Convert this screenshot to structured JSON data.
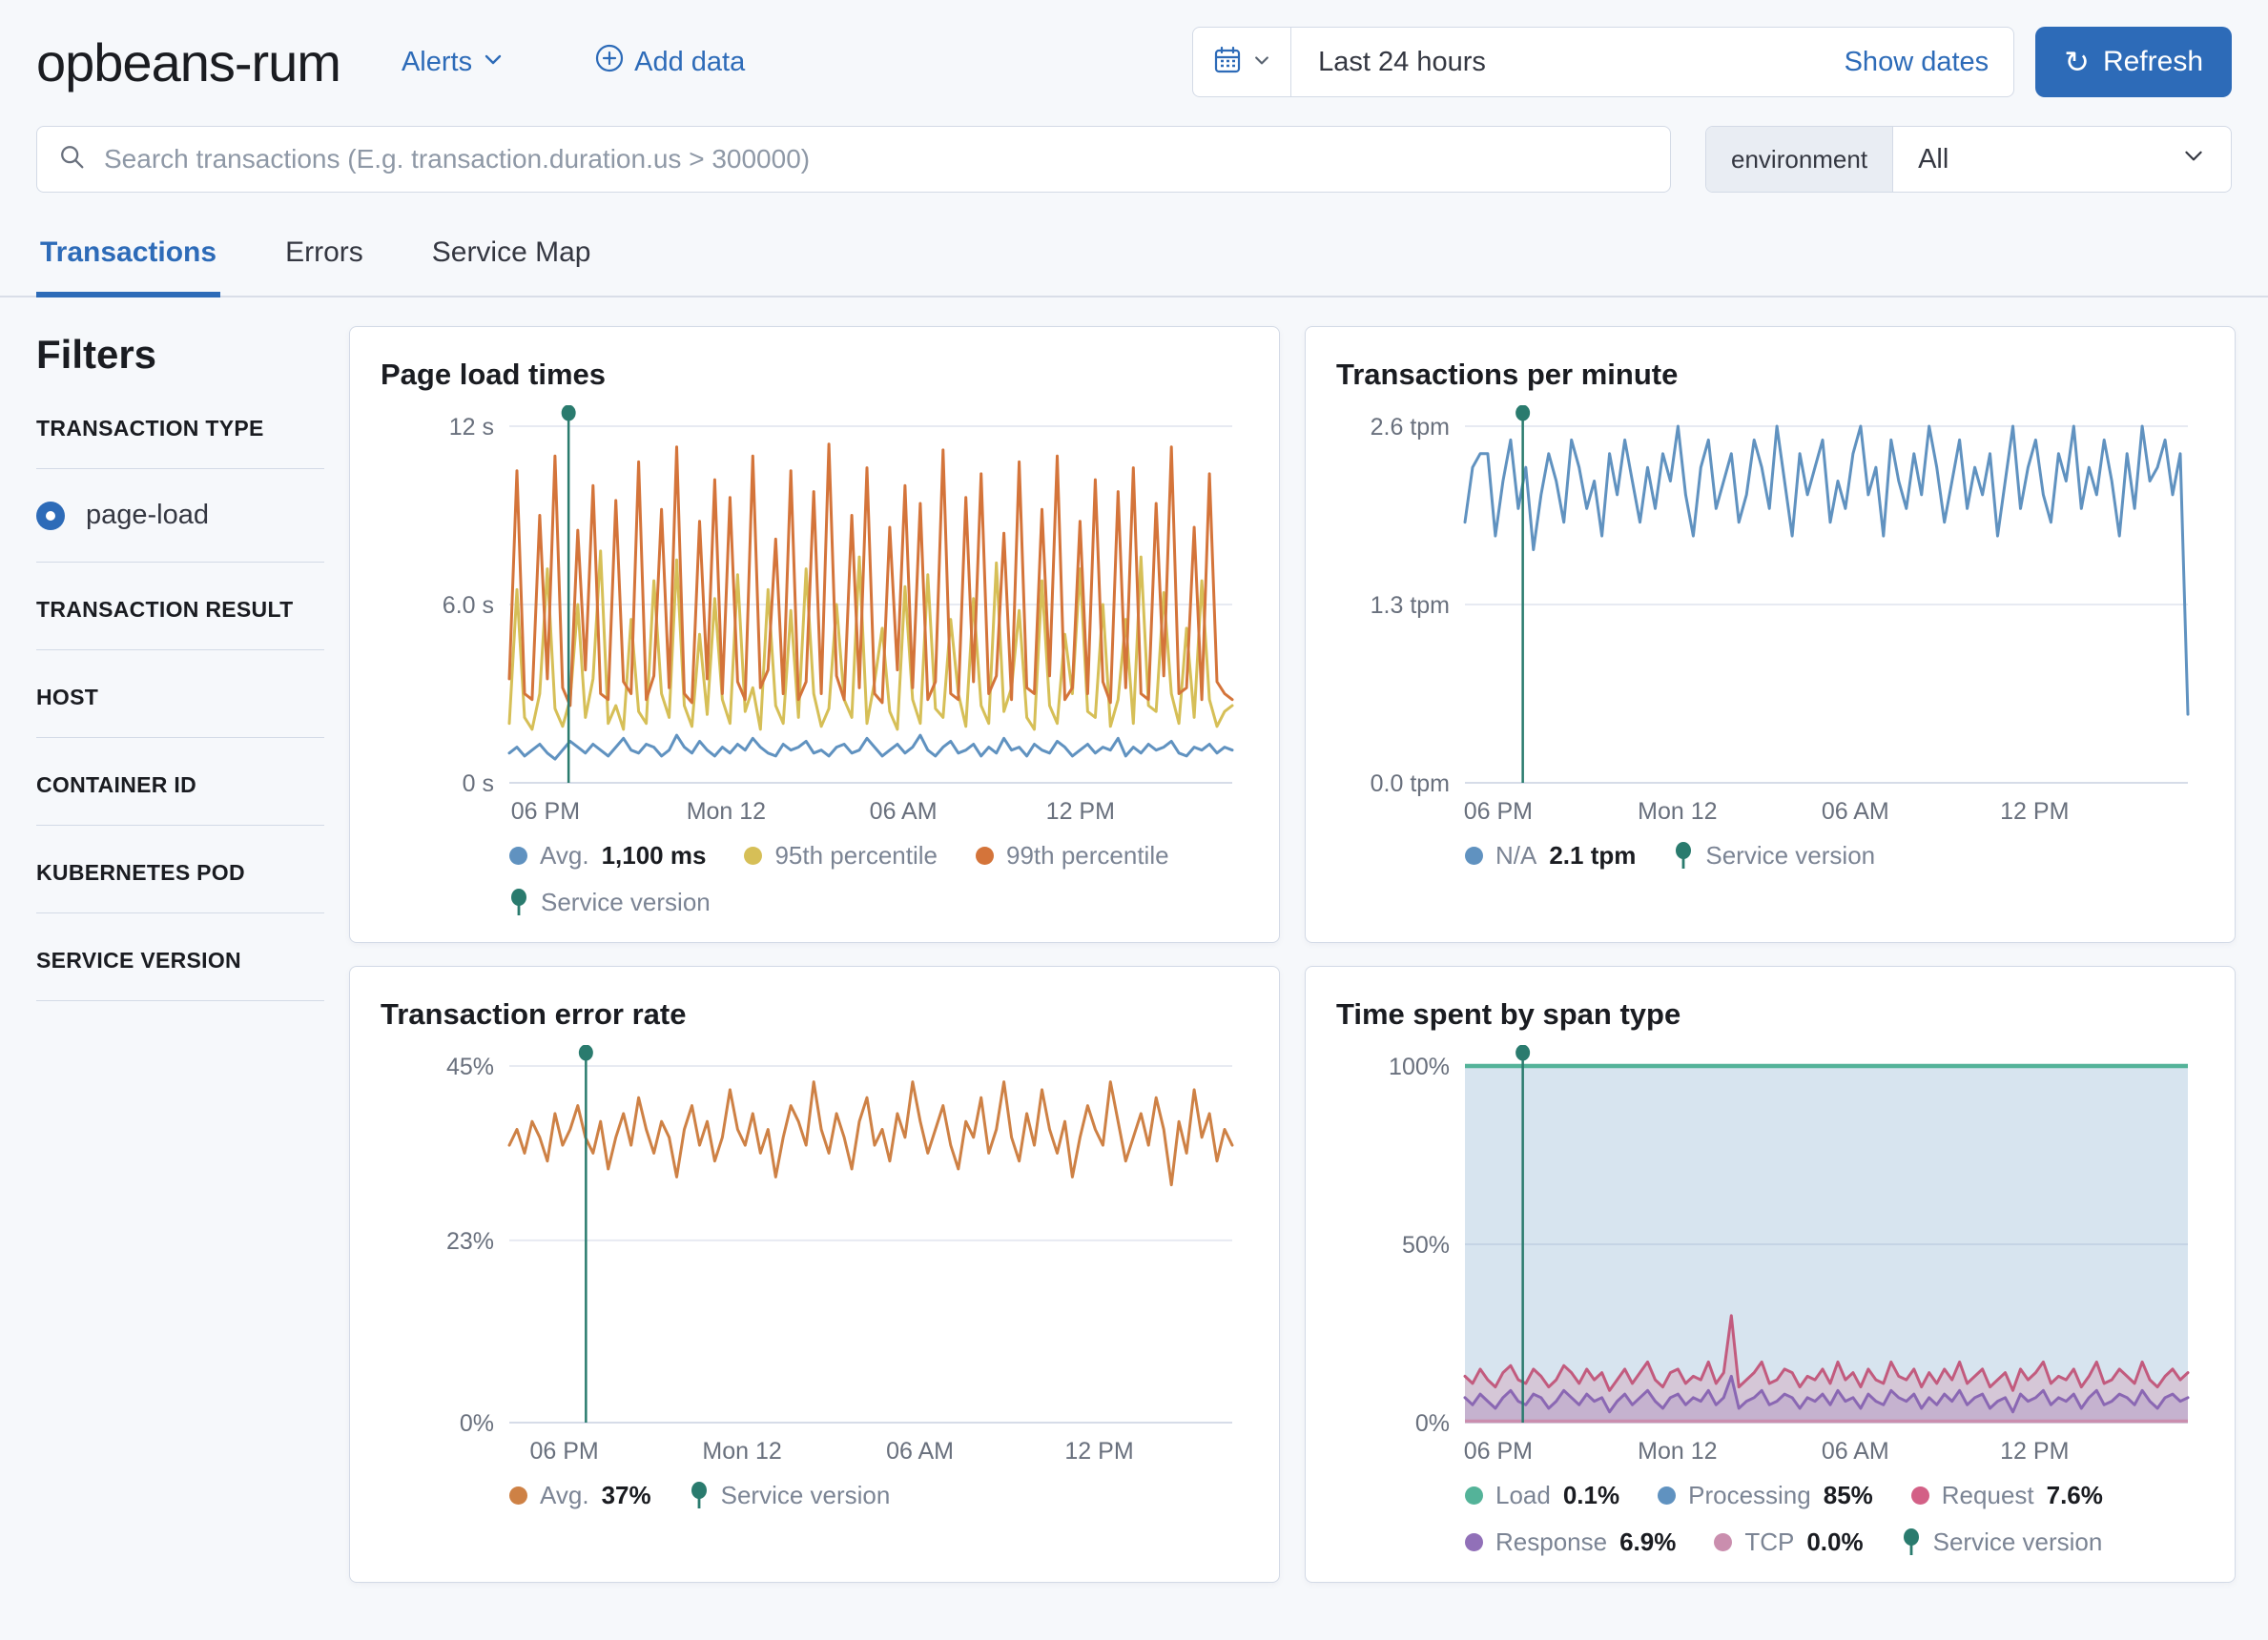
{
  "header": {
    "title": "opbeans-rum",
    "alerts_label": "Alerts",
    "add_data_label": "Add data",
    "time_range": "Last 24 hours",
    "show_dates_label": "Show dates",
    "refresh_label": "Refresh"
  },
  "search": {
    "placeholder": "Search transactions (E.g. transaction.duration.us > 300000)",
    "environment_label": "environment",
    "environment_value": "All"
  },
  "tabs": [
    {
      "label": "Transactions",
      "active": true
    },
    {
      "label": "Errors",
      "active": false
    },
    {
      "label": "Service Map",
      "active": false
    }
  ],
  "filters": {
    "title": "Filters",
    "groups": [
      {
        "label": "TRANSACTION TYPE",
        "options": [
          {
            "label": "page-load",
            "selected": true
          }
        ]
      },
      {
        "label": "TRANSACTION RESULT",
        "options": []
      },
      {
        "label": "HOST",
        "options": []
      },
      {
        "label": "CONTAINER ID",
        "options": []
      },
      {
        "label": "KUBERNETES POD",
        "options": []
      },
      {
        "label": "SERVICE VERSION",
        "options": []
      }
    ]
  },
  "colors": {
    "primary_blue": "#2d6bb8",
    "series_blue": "#6092C0",
    "series_yellow": "#D6BF57",
    "series_orange_99th": "#D4743A",
    "series_orange_avg": "#CE8145",
    "series_green": "#54B399",
    "series_pink": "#D36086",
    "series_purple": "#9170B8",
    "series_light_pink": "#CA8EAE",
    "annotation_teal": "#2a7b6e",
    "border": "#d3dae6",
    "page_bg": "#f6f8fb"
  },
  "chart_data": [
    {
      "type": "line",
      "title": "Page load times",
      "ylim": [
        0,
        12
      ],
      "y_ticks": [
        {
          "label": "12 s",
          "value": 12
        },
        {
          "label": "6.0 s",
          "value": 6
        },
        {
          "label": "0 s",
          "value": 0
        }
      ],
      "x_ticks": [
        "06 PM",
        "Mon 12",
        "06 AM",
        "12 PM"
      ],
      "x_tick_fracs": [
        0.05,
        0.3,
        0.545,
        0.79
      ],
      "annotation": {
        "label": "Service version",
        "x_frac": 0.082,
        "color": "#2a7b6e"
      },
      "series": [
        {
          "name": "95th percentile",
          "color": "#D6BF57",
          "values": [
            2.0,
            6.5,
            2.2,
            1.8,
            3.0,
            7.2,
            2.5,
            1.9,
            2.8,
            6.0,
            2.2,
            3.5,
            7.8,
            2.0,
            2.6,
            1.8,
            5.5,
            2.4,
            2.0,
            6.8,
            3.0,
            2.2,
            7.5,
            2.6,
            1.9,
            5.0,
            2.3,
            6.2,
            2.8,
            2.0,
            7.0,
            2.4,
            3.2,
            1.8,
            6.5,
            2.6,
            2.0,
            5.8,
            2.2,
            7.2,
            3.0,
            1.9,
            2.5,
            6.0,
            2.8,
            2.2,
            7.6,
            2.0,
            3.4,
            5.2,
            2.4,
            1.8,
            6.6,
            2.8,
            2.0,
            7.0,
            2.5,
            2.2,
            5.5,
            3.0,
            1.9,
            6.2,
            2.6,
            2.0,
            7.4,
            2.4,
            3.2,
            5.8,
            2.2,
            1.8,
            6.8,
            2.6,
            2.0,
            5.0,
            3.0,
            7.2,
            2.4,
            2.2,
            6.0,
            1.9,
            2.8,
            5.5,
            2.0,
            7.6,
            2.6,
            2.4,
            6.4,
            3.0,
            2.0,
            5.2,
            2.2,
            6.8,
            2.8,
            1.9,
            2.4,
            2.6
          ]
        },
        {
          "name": "99th percentile",
          "color": "#D4743A",
          "values": [
            3.5,
            10.5,
            3.0,
            2.8,
            9.0,
            3.5,
            11.0,
            3.2,
            2.6,
            8.5,
            3.8,
            10.0,
            3.0,
            2.8,
            9.5,
            3.4,
            3.0,
            10.8,
            2.8,
            3.6,
            9.2,
            3.2,
            11.3,
            3.0,
            2.7,
            8.8,
            3.5,
            10.2,
            3.0,
            9.6,
            3.4,
            2.8,
            11.0,
            3.2,
            3.8,
            8.2,
            3.0,
            10.5,
            2.8,
            3.4,
            9.8,
            3.0,
            11.4,
            3.6,
            2.8,
            9.0,
            3.2,
            10.6,
            3.0,
            2.7,
            8.6,
            3.8,
            10.0,
            3.2,
            9.4,
            2.8,
            3.4,
            11.2,
            3.0,
            2.8,
            9.6,
            3.4,
            10.4,
            3.0,
            3.6,
            8.4,
            2.8,
            10.8,
            3.2,
            3.0,
            9.2,
            3.6,
            11.0,
            2.8,
            3.2,
            8.8,
            3.0,
            10.2,
            3.4,
            2.7,
            9.8,
            3.2,
            10.6,
            3.0,
            2.8,
            9.4,
            3.6,
            11.3,
            3.0,
            3.2,
            8.6,
            2.8,
            10.4,
            3.4,
            3.0,
            2.8
          ]
        },
        {
          "name": "Avg.",
          "color": "#6092C0",
          "values": [
            1.0,
            1.2,
            0.9,
            1.1,
            1.3,
            1.0,
            0.8,
            1.1,
            1.4,
            1.2,
            1.0,
            1.3,
            1.1,
            0.9,
            1.2,
            1.5,
            1.1,
            1.0,
            1.3,
            1.2,
            0.9,
            1.1,
            1.6,
            1.2,
            1.0,
            1.4,
            1.1,
            0.9,
            1.2,
            1.0,
            1.3,
            1.1,
            1.5,
            1.2,
            1.0,
            0.9,
            1.3,
            1.1,
            1.2,
            1.4,
            1.0,
            1.1,
            0.9,
            1.2,
            1.3,
            1.0,
            1.1,
            1.5,
            1.2,
            0.9,
            1.1,
            1.3,
            1.0,
            1.2,
            1.6,
            1.1,
            0.9,
            1.2,
            1.4,
            1.0,
            1.1,
            1.3,
            0.9,
            1.2,
            1.0,
            1.5,
            1.1,
            1.2,
            0.9,
            1.3,
            1.1,
            1.0,
            1.4,
            1.2,
            0.9,
            1.1,
            1.3,
            1.0,
            1.2,
            1.1,
            1.5,
            0.9,
            1.2,
            1.0,
            1.3,
            1.1,
            1.2,
            1.4,
            1.0,
            0.9,
            1.2,
            1.1,
            1.3,
            1.0,
            1.2,
            1.1
          ]
        }
      ],
      "legend": [
        {
          "swatch": "dot",
          "color": "#6092C0",
          "label": "Avg.",
          "value": "1,100 ms"
        },
        {
          "swatch": "dot",
          "color": "#D6BF57",
          "label": "95th percentile",
          "value": ""
        },
        {
          "swatch": "dot",
          "color": "#D4743A",
          "label": "99th percentile",
          "value": ""
        },
        {
          "swatch": "pin",
          "color": "#2a7b6e",
          "label": "Service version",
          "value": ""
        }
      ]
    },
    {
      "type": "line",
      "title": "Transactions per minute",
      "ylim": [
        0,
        2.6
      ],
      "y_ticks": [
        {
          "label": "2.6 tpm",
          "value": 2.6
        },
        {
          "label": "1.3 tpm",
          "value": 1.3
        },
        {
          "label": "0.0 tpm",
          "value": 0
        }
      ],
      "x_ticks": [
        "06 PM",
        "Mon 12",
        "06 AM",
        "12 PM"
      ],
      "x_tick_fracs": [
        0.046,
        0.294,
        0.54,
        0.788
      ],
      "annotation": {
        "label": "Service version",
        "x_frac": 0.08,
        "color": "#2a7b6e"
      },
      "series": [
        {
          "name": "N/A",
          "color": "#6092C0",
          "values": [
            1.9,
            2.3,
            2.4,
            2.4,
            1.8,
            2.2,
            2.5,
            2.0,
            2.3,
            1.7,
            2.1,
            2.4,
            2.2,
            1.9,
            2.5,
            2.3,
            2.0,
            2.2,
            1.8,
            2.4,
            2.1,
            2.5,
            2.2,
            1.9,
            2.3,
            2.0,
            2.4,
            2.2,
            2.6,
            2.1,
            1.8,
            2.3,
            2.5,
            2.0,
            2.2,
            2.4,
            1.9,
            2.1,
            2.5,
            2.3,
            2.0,
            2.6,
            2.2,
            1.8,
            2.4,
            2.1,
            2.3,
            2.5,
            1.9,
            2.2,
            2.0,
            2.4,
            2.6,
            2.1,
            2.3,
            1.8,
            2.5,
            2.2,
            2.0,
            2.4,
            2.1,
            2.6,
            2.3,
            1.9,
            2.2,
            2.5,
            2.0,
            2.3,
            2.1,
            2.4,
            1.8,
            2.2,
            2.6,
            2.0,
            2.3,
            2.5,
            2.1,
            1.9,
            2.4,
            2.2,
            2.6,
            2.0,
            2.3,
            2.1,
            2.5,
            2.2,
            1.8,
            2.4,
            2.0,
            2.6,
            2.2,
            2.3,
            2.5,
            2.1,
            2.4,
            0.5
          ]
        }
      ],
      "legend": [
        {
          "swatch": "dot",
          "color": "#6092C0",
          "label": "N/A",
          "value": "2.1 tpm"
        },
        {
          "swatch": "pin",
          "color": "#2a7b6e",
          "label": "Service version",
          "value": ""
        }
      ]
    },
    {
      "type": "line",
      "title": "Transaction error rate",
      "ylim": [
        0,
        45
      ],
      "y_ticks": [
        {
          "label": "45%",
          "value": 45
        },
        {
          "label": "23%",
          "value": 23
        },
        {
          "label": "0%",
          "value": 0
        }
      ],
      "x_ticks": [
        "06 PM",
        "Mon 12",
        "06 AM",
        "12 PM"
      ],
      "x_tick_fracs": [
        0.076,
        0.322,
        0.568,
        0.816
      ],
      "annotation": {
        "label": "Service version",
        "x_frac": 0.106,
        "color": "#2a7b6e"
      },
      "series": [
        {
          "name": "Avg.",
          "color": "#CE8145",
          "values": [
            35,
            37,
            34,
            38,
            36,
            33,
            39,
            35,
            37,
            40,
            36,
            34,
            38,
            32,
            36,
            39,
            35,
            41,
            37,
            34,
            38,
            36,
            31,
            37,
            40,
            35,
            38,
            33,
            36,
            42,
            37,
            35,
            39,
            34,
            37,
            31,
            36,
            40,
            38,
            35,
            43,
            37,
            34,
            39,
            36,
            32,
            38,
            41,
            35,
            37,
            33,
            39,
            36,
            43,
            38,
            34,
            37,
            40,
            35,
            32,
            38,
            36,
            41,
            34,
            37,
            43,
            36,
            33,
            39,
            35,
            42,
            37,
            34,
            38,
            31,
            36,
            40,
            37,
            35,
            43,
            38,
            33,
            36,
            39,
            35,
            41,
            37,
            30,
            38,
            34,
            42,
            36,
            39,
            33,
            37,
            35
          ]
        }
      ],
      "legend": [
        {
          "swatch": "dot",
          "color": "#CE8145",
          "label": "Avg.",
          "value": "37%"
        },
        {
          "swatch": "pin",
          "color": "#2a7b6e",
          "label": "Service version",
          "value": ""
        }
      ]
    },
    {
      "type": "area",
      "stacked": true,
      "title": "Time spent by span type",
      "ylim": [
        0,
        100
      ],
      "y_ticks": [
        {
          "label": "100%",
          "value": 100
        },
        {
          "label": "50%",
          "value": 50
        },
        {
          "label": "0%",
          "value": 0
        }
      ],
      "x_ticks": [
        "06 PM",
        "Mon 12",
        "06 AM",
        "12 PM"
      ],
      "x_tick_fracs": [
        0.046,
        0.294,
        0.54,
        0.788
      ],
      "annotation": {
        "label": "Service version",
        "x_frac": 0.08,
        "color": "#2a7b6e"
      },
      "series": [
        {
          "name": "Load",
          "color": "#54B399",
          "role": "top-line",
          "level": 100
        },
        {
          "name": "Processing",
          "color": "#6092C0",
          "role": "fill-full"
        },
        {
          "name": "Request",
          "color": "#D36086",
          "role": "band",
          "values": [
            13,
            11,
            15,
            12,
            10,
            14,
            16,
            12,
            11,
            15,
            13,
            10,
            12,
            16,
            14,
            11,
            15,
            12,
            14,
            9,
            12,
            15,
            11,
            14,
            17,
            12,
            10,
            14,
            15,
            11,
            13,
            12,
            17,
            11,
            14,
            30,
            10,
            12,
            14,
            17,
            11,
            12,
            15,
            14,
            10,
            13,
            12,
            15,
            11,
            17,
            12,
            14,
            10,
            15,
            12,
            11,
            17,
            13,
            12,
            15,
            10,
            14,
            11,
            15,
            12,
            17,
            11,
            13,
            15,
            10,
            12,
            14,
            9,
            15,
            12,
            14,
            17,
            11,
            13,
            12,
            15,
            10,
            13,
            17,
            11,
            12,
            15,
            13,
            11,
            17,
            12,
            10,
            13,
            15,
            12,
            14
          ]
        },
        {
          "name": "Response",
          "color": "#9170B8",
          "role": "band",
          "values": [
            7,
            5,
            8,
            6,
            4,
            7,
            9,
            6,
            5,
            8,
            7,
            4,
            6,
            9,
            7,
            5,
            8,
            6,
            7,
            3,
            6,
            8,
            5,
            7,
            9,
            6,
            4,
            7,
            8,
            5,
            7,
            6,
            9,
            5,
            7,
            13,
            4,
            6,
            7,
            9,
            5,
            6,
            8,
            7,
            4,
            7,
            6,
            8,
            5,
            9,
            6,
            7,
            4,
            8,
            6,
            5,
            9,
            7,
            6,
            8,
            4,
            7,
            5,
            8,
            6,
            9,
            5,
            7,
            8,
            4,
            6,
            7,
            3,
            8,
            6,
            7,
            9,
            5,
            7,
            6,
            8,
            4,
            7,
            9,
            5,
            6,
            8,
            7,
            5,
            9,
            6,
            4,
            7,
            8,
            6,
            7
          ]
        },
        {
          "name": "TCP",
          "color": "#CA8EAE",
          "role": "bottom-line",
          "level": 0.4
        }
      ],
      "legend": [
        {
          "swatch": "dot",
          "color": "#54B399",
          "label": "Load",
          "value": "0.1%"
        },
        {
          "swatch": "dot",
          "color": "#6092C0",
          "label": "Processing",
          "value": "85%"
        },
        {
          "swatch": "dot",
          "color": "#D36086",
          "label": "Request",
          "value": "7.6%"
        },
        {
          "swatch": "dot",
          "color": "#9170B8",
          "label": "Response",
          "value": "6.9%"
        },
        {
          "swatch": "dot",
          "color": "#CA8EAE",
          "label": "TCP",
          "value": "0.0%"
        },
        {
          "swatch": "pin",
          "color": "#2a7b6e",
          "label": "Service version",
          "value": ""
        }
      ]
    }
  ]
}
